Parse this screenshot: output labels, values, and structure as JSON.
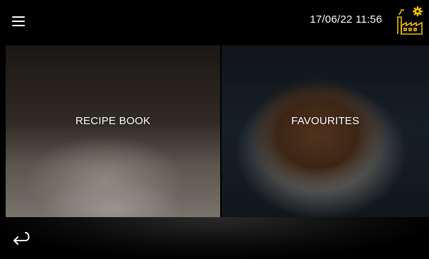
{
  "header": {
    "datetime": "17/06/22 11:56",
    "menu_icon": "hamburger-menu-icon",
    "factory_icon": "factory-icon",
    "accent_color": "#f2c200"
  },
  "tiles": [
    {
      "label": "RECIPE BOOK"
    },
    {
      "label": "FAVOURITES"
    }
  ],
  "footer": {
    "back_icon": "return-arrow-icon"
  }
}
